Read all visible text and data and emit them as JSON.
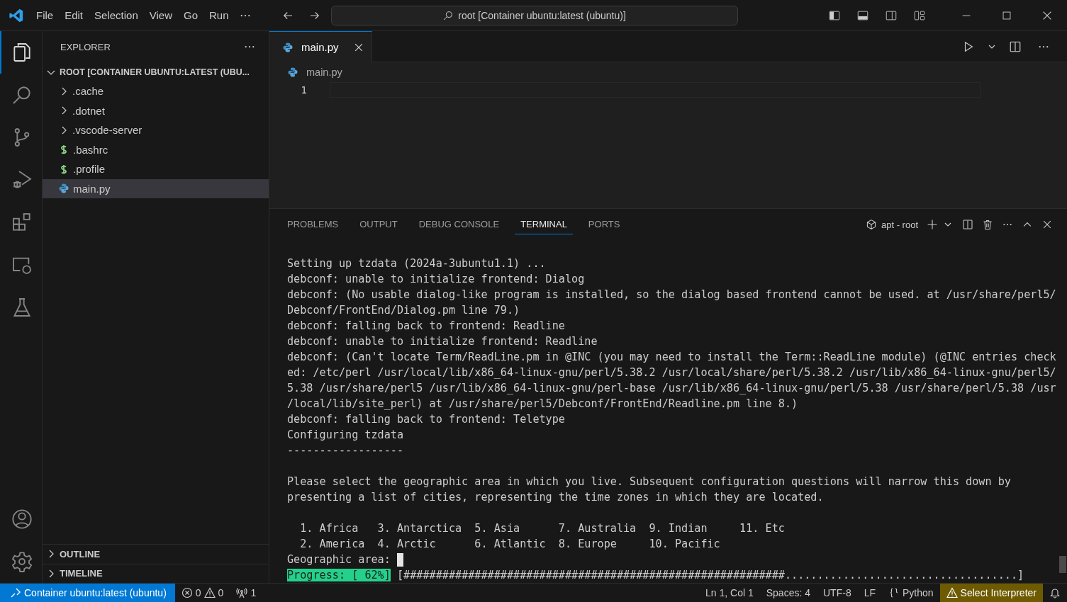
{
  "title_bar": {
    "menu": [
      "File",
      "Edit",
      "Selection",
      "View",
      "Go",
      "Run"
    ],
    "command_center": "root [Container ubuntu:latest (ubuntu)]"
  },
  "activity_bar": {
    "top": [
      {
        "kind": "explorer",
        "selected": true
      },
      {
        "kind": "search",
        "selected": false
      },
      {
        "kind": "source-control",
        "selected": false
      },
      {
        "kind": "run-debug",
        "selected": false
      },
      {
        "kind": "extensions",
        "selected": false
      },
      {
        "kind": "remote",
        "selected": false
      },
      {
        "kind": "testing",
        "selected": false
      }
    ],
    "bottom": [
      {
        "kind": "account",
        "selected": false
      },
      {
        "kind": "settings",
        "selected": false
      }
    ]
  },
  "sidebar": {
    "title": "EXPLORER",
    "root": {
      "label": "ROOT [CONTAINER UBUNTU:LATEST (UBU...",
      "expanded": true,
      "children": [
        {
          "label": ".cache",
          "kind": "folder",
          "expanded": false,
          "selected": false
        },
        {
          "label": ".dotnet",
          "kind": "folder",
          "expanded": false,
          "selected": false
        },
        {
          "label": ".vscode-server",
          "kind": "folder",
          "expanded": false,
          "selected": false
        },
        {
          "label": ".bashrc",
          "kind": "shell",
          "selected": false
        },
        {
          "label": ".profile",
          "kind": "shell",
          "selected": false
        },
        {
          "label": "main.py",
          "kind": "python",
          "selected": true
        }
      ]
    },
    "sections": [
      {
        "label": "OUTLINE",
        "expanded": false
      },
      {
        "label": "TIMELINE",
        "expanded": false
      }
    ]
  },
  "editor": {
    "tabs": [
      {
        "label": "main.py",
        "kind": "python",
        "selected": true
      }
    ],
    "breadcrumb": "main.py",
    "line_numbers": [
      "1"
    ]
  },
  "panel": {
    "tabs": [
      {
        "label": "PROBLEMS",
        "selected": false
      },
      {
        "label": "OUTPUT",
        "selected": false
      },
      {
        "label": "DEBUG CONSOLE",
        "selected": false
      },
      {
        "label": "TERMINAL",
        "selected": true
      },
      {
        "label": "PORTS",
        "selected": false
      }
    ],
    "terminal_name": "apt - root",
    "terminal_lines": [
      {
        "kind": "text",
        "text": "Setting up tzdata (2024a-3ubuntu1.1) ..."
      },
      {
        "kind": "text",
        "text": "debconf: unable to initialize frontend: Dialog"
      },
      {
        "kind": "text",
        "text": "debconf: (No usable dialog-like program is installed, so the dialog based frontend cannot be used. at /usr/share/perl5/"
      },
      {
        "kind": "text",
        "text": "Debconf/FrontEnd/Dialog.pm line 79.)"
      },
      {
        "kind": "text",
        "text": "debconf: falling back to frontend: Readline"
      },
      {
        "kind": "text",
        "text": "debconf: unable to initialize frontend: Readline"
      },
      {
        "kind": "text",
        "text": "debconf: (Can't locate Term/ReadLine.pm in @INC (you may need to install the Term::ReadLine module) (@INC entries check"
      },
      {
        "kind": "text",
        "text": "ed: /etc/perl /usr/local/lib/x86_64-linux-gnu/perl/5.38.2 /usr/local/share/perl/5.38.2 /usr/lib/x86_64-linux-gnu/perl5/"
      },
      {
        "kind": "text",
        "text": "5.38 /usr/share/perl5 /usr/lib/x86_64-linux-gnu/perl-base /usr/lib/x86_64-linux-gnu/perl/5.38 /usr/share/perl/5.38 /usr"
      },
      {
        "kind": "text",
        "text": "/local/lib/site_perl) at /usr/share/perl5/Debconf/FrontEnd/Readline.pm line 8.)"
      },
      {
        "kind": "text",
        "text": "debconf: falling back to frontend: Teletype"
      },
      {
        "kind": "text",
        "text": "Configuring tzdata"
      },
      {
        "kind": "text",
        "text": "------------------"
      },
      {
        "kind": "blank"
      },
      {
        "kind": "text",
        "text": "Please select the geographic area in which you live. Subsequent configuration questions will narrow this down by"
      },
      {
        "kind": "text",
        "text": "presenting a list of cities, representing the time zones in which they are located."
      },
      {
        "kind": "blank"
      },
      {
        "kind": "text",
        "text": "  1. Africa   3. Antarctica  5. Asia      7. Australia  9. Indian     11. Etc"
      },
      {
        "kind": "text",
        "text": "  2. America  4. Arctic      6. Atlantic  8. Europe     10. Pacific"
      },
      {
        "kind": "prompt",
        "text": "Geographic area: "
      },
      {
        "kind": "progress",
        "label": "Progress: [ 62%]",
        "bar": "[###########################################################....................................]"
      }
    ]
  },
  "status_bar": {
    "left": [
      {
        "kind": "remote",
        "text": "Container ubuntu:latest (ubuntu)"
      },
      {
        "kind": "problems",
        "errors": "0",
        "warnings": "0"
      },
      {
        "kind": "ports",
        "text": "1"
      }
    ],
    "right": [
      {
        "kind": "text",
        "text": "Ln 1, Col 1"
      },
      {
        "kind": "text",
        "text": "Spaces: 4"
      },
      {
        "kind": "text",
        "text": "UTF-8"
      },
      {
        "kind": "text",
        "text": "LF"
      },
      {
        "kind": "language",
        "text": "Python"
      },
      {
        "kind": "warning",
        "text": "Select Interpreter"
      },
      {
        "kind": "bell"
      }
    ]
  }
}
